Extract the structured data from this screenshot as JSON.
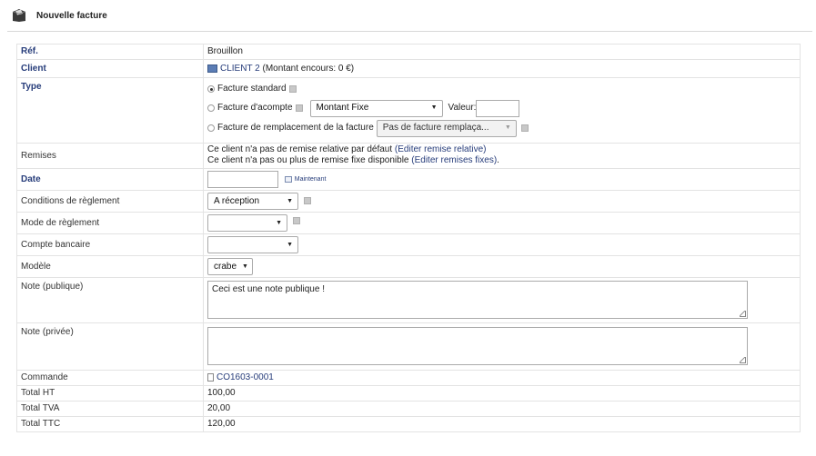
{
  "header": {
    "title": "Nouvelle facture",
    "icon": "bill-icon"
  },
  "rows": {
    "ref": {
      "label": "Réf.",
      "value": "Brouillon"
    },
    "client": {
      "label": "Client",
      "name": "CLIENT 2",
      "outstanding": "(Montant encours: 0 €)"
    },
    "type": {
      "label": "Type",
      "standard": "Facture standard",
      "deposit": "Facture d'acompte",
      "deposit_mode": "Montant Fixe",
      "value_label": "Valeur:",
      "value": "",
      "replacement": "Facture de remplacement de la facture",
      "replacement_select": "Pas de facture remplaça..."
    },
    "discounts": {
      "label": "Remises",
      "line1_text": "Ce client n'a pas de remise relative par défaut",
      "line1_link": "(Editer remise relative)",
      "line2_text": "Ce client n'a pas ou plus de remise fixe disponible",
      "line2_link": "(Editer remises fixes)",
      "line2_end": "."
    },
    "date": {
      "label": "Date",
      "value": "",
      "now_label": "Maintenant"
    },
    "payment_terms": {
      "label": "Conditions de règlement",
      "value": "A réception"
    },
    "payment_mode": {
      "label": "Mode de règlement",
      "value": ""
    },
    "bank_account": {
      "label": "Compte bancaire",
      "value": ""
    },
    "model": {
      "label": "Modèle",
      "value": "crabe"
    },
    "note_public": {
      "label": "Note (publique)",
      "value": "Ceci est une note publique !"
    },
    "note_private": {
      "label": "Note (privée)",
      "value": ""
    },
    "order": {
      "label": "Commande",
      "value": "CO1603-0001"
    },
    "total_ht": {
      "label": "Total HT",
      "value": "100,00"
    },
    "total_tva": {
      "label": "Total TVA",
      "value": "20,00"
    },
    "total_ttc": {
      "label": "Total TTC",
      "value": "120,00"
    }
  },
  "colors": {
    "link": "#263c7a",
    "border": "#e3e3e3"
  }
}
